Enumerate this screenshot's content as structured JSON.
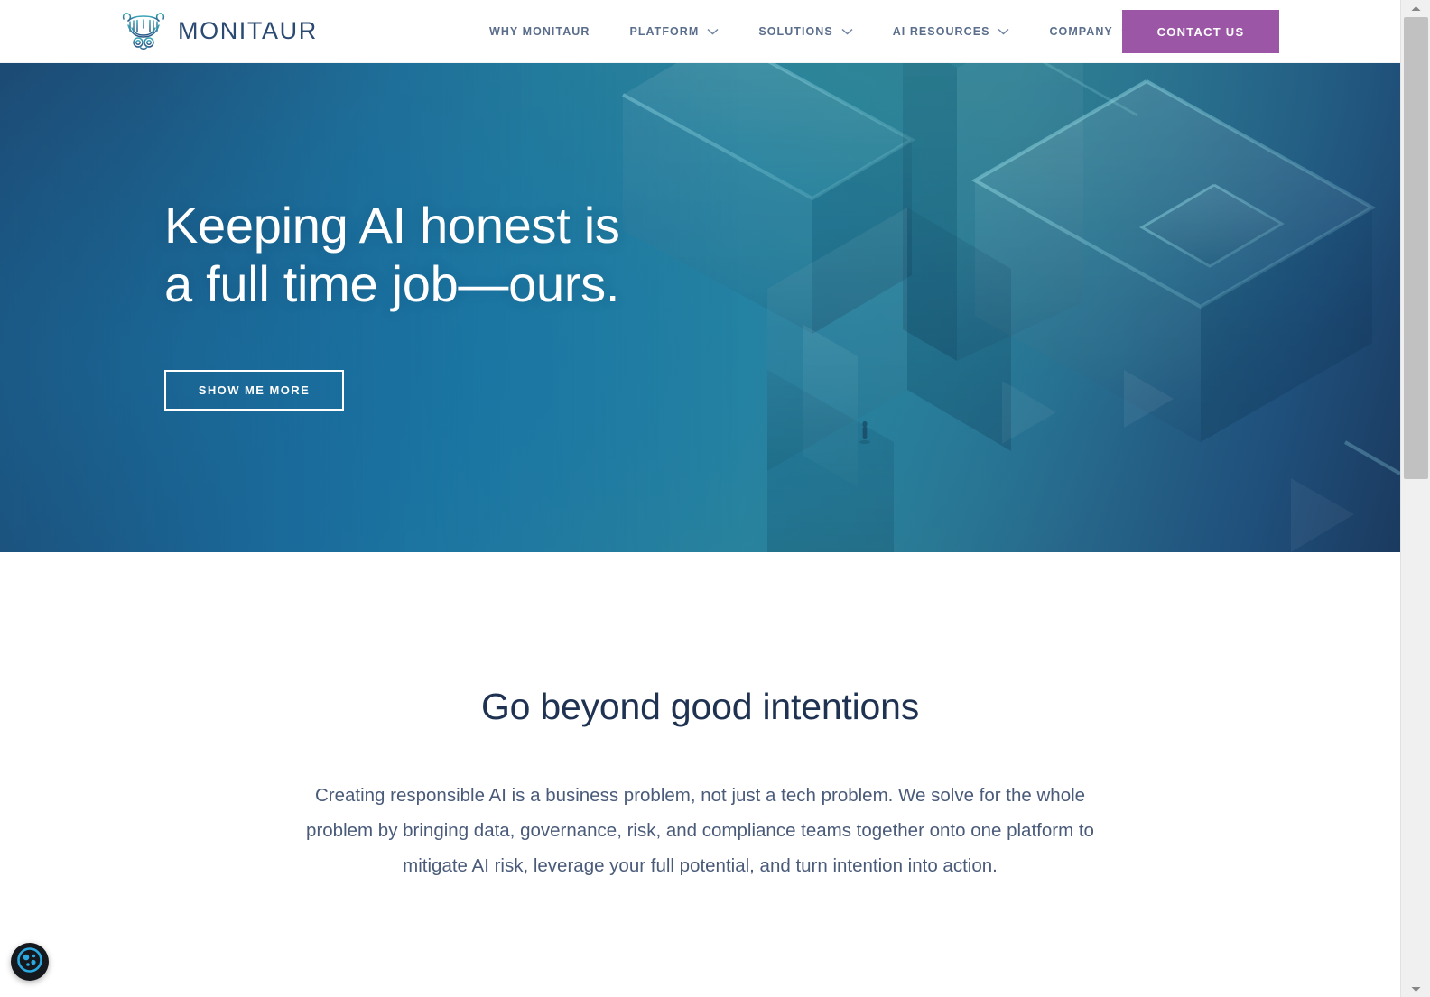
{
  "brand": {
    "name": "MONITAUR",
    "logo_icon": "minotaur-bull-logo-icon",
    "logo_color_start": "#3aa8b8",
    "logo_color_end": "#2b4a72"
  },
  "header": {
    "nav_items": [
      {
        "label": "WHY MONITAUR",
        "has_dropdown": false
      },
      {
        "label": "PLATFORM",
        "has_dropdown": true
      },
      {
        "label": "SOLUTIONS",
        "has_dropdown": true
      },
      {
        "label": "AI RESOURCES",
        "has_dropdown": true
      },
      {
        "label": "COMPANY",
        "has_dropdown": true
      }
    ],
    "cta": {
      "label": "CONTACT US",
      "background": "#9b57a5",
      "text_color": "#ffffff"
    },
    "nav_text_color": "#5a6e8c"
  },
  "hero": {
    "title_line_1": "Keeping AI honest is",
    "title_line_2": "a full time job—ours.",
    "button_label": "SHOW ME MORE",
    "background_description": "isometric teal-blue maze illustration with a small human figure",
    "gradient_start": "#1c3d63",
    "gradient_mid": "#1a76ac",
    "gradient_teal": "#2f8597",
    "gradient_end": "#1b3a5f",
    "text_color": "#ffffff"
  },
  "section": {
    "heading": "Go beyond good intentions",
    "heading_color": "#1f3252",
    "paragraph": "Creating responsible AI is a business problem, not just a tech problem. We solve for the whole problem by bringing data, governance, risk, and compliance teams together onto one platform to mitigate AI risk, leverage your full potential, and turn intention into action.",
    "paragraph_color": "#4a5b7a"
  },
  "cookie_widget": {
    "icon": "cookie-consent-icon",
    "background": "#15181c",
    "accent": "#2aa8e0"
  },
  "scrollbar": {
    "track_color": "#f0f0f0",
    "thumb_color": "#c1c1c1",
    "up_arrow_icon": "scroll-up-arrow-icon",
    "down_arrow_icon": "scroll-down-arrow-icon"
  }
}
